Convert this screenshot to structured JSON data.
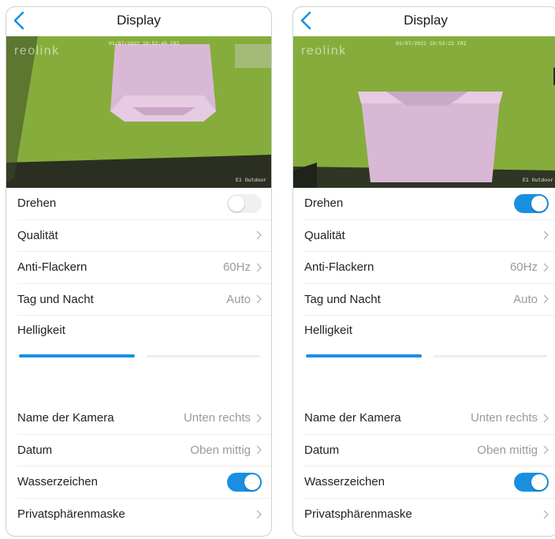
{
  "screens": [
    {
      "title": "Display",
      "camera": {
        "brand": "reolink",
        "timestamp": "01/07/2022 10:52:45 FRI",
        "label": "E1 Outdoor"
      },
      "rows_top": [
        {
          "label": "Drehen",
          "type": "toggle",
          "on": false
        },
        {
          "label": "Qualität",
          "type": "chevron",
          "value": ""
        },
        {
          "label": "Anti-Flackern",
          "type": "chevron",
          "value": "60Hz"
        },
        {
          "label": "Tag und Nacht",
          "type": "chevron",
          "value": "Auto"
        }
      ],
      "brightness": {
        "label": "Helligkeit",
        "level": 0.5
      },
      "rows_bottom": [
        {
          "label": "Name der Kamera",
          "type": "chevron",
          "value": "Unten rechts"
        },
        {
          "label": "Datum",
          "type": "chevron",
          "value": "Oben mittig"
        },
        {
          "label": "Wasserzeichen",
          "type": "toggle",
          "on": true
        },
        {
          "label": "Privatsphärenmaske",
          "type": "chevron",
          "value": ""
        }
      ]
    },
    {
      "title": "Display",
      "camera": {
        "brand": "reolink",
        "timestamp": "01/07/2022 10:53:22 FRI",
        "label": "E1 Outdoor"
      },
      "rows_top": [
        {
          "label": "Drehen",
          "type": "toggle",
          "on": true
        },
        {
          "label": "Qualität",
          "type": "chevron",
          "value": ""
        },
        {
          "label": "Anti-Flackern",
          "type": "chevron",
          "value": "60Hz"
        },
        {
          "label": "Tag und Nacht",
          "type": "chevron",
          "value": "Auto"
        }
      ],
      "brightness": {
        "label": "Helligkeit",
        "level": 0.5
      },
      "rows_bottom": [
        {
          "label": "Name der Kamera",
          "type": "chevron",
          "value": "Unten rechts"
        },
        {
          "label": "Datum",
          "type": "chevron",
          "value": "Oben mittig"
        },
        {
          "label": "Wasserzeichen",
          "type": "toggle",
          "on": true
        },
        {
          "label": "Privatsphärenmaske",
          "type": "chevron",
          "value": ""
        }
      ]
    }
  ],
  "colors": {
    "accent": "#1a8fe0",
    "toggle_off": "#f0f0f0",
    "value_text": "#9a9a9a",
    "divider": "#ededed",
    "scene_green": "#7fa63a"
  },
  "icons": {
    "back": "chevron-left-icon",
    "row": "chevron-right-icon"
  }
}
